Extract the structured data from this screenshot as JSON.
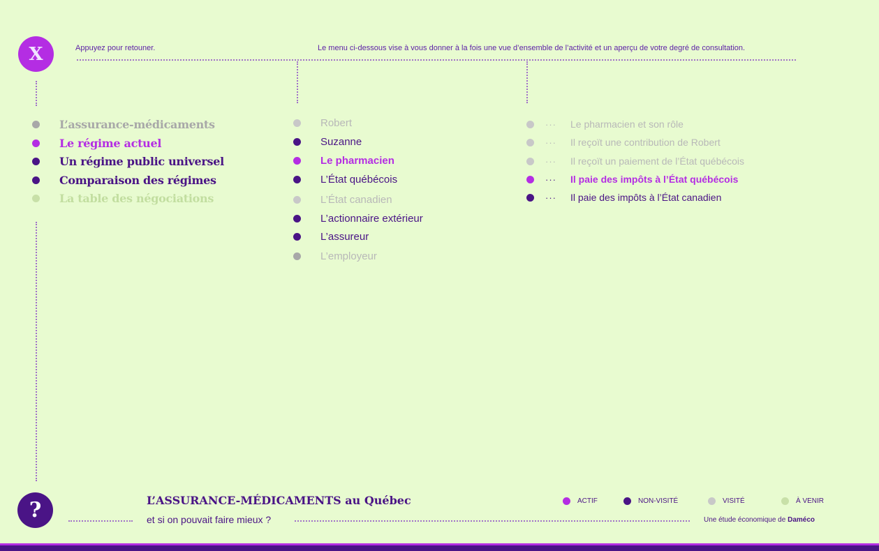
{
  "header": {
    "close_icon": "x-icon",
    "close_glyph": "X",
    "back_text": "Appuyez pour retouner.",
    "description": "Le menu ci-dessous vise à vous donner à la fois une vue d’ensemble de l’activité et un aperçu de votre degré de consultation."
  },
  "column1": [
    {
      "label": "L’assurance-médicaments",
      "state": "gray"
    },
    {
      "label": "Le régime actuel",
      "state": "active"
    },
    {
      "label": "Un régime public universel",
      "state": "unvisited"
    },
    {
      "label": "Comparaison des régimes",
      "state": "unvisited"
    },
    {
      "label": "La table des négociations",
      "state": "upcoming"
    }
  ],
  "column2": [
    {
      "label": "Robert",
      "state": "visited"
    },
    {
      "label": "Suzanne",
      "state": "unvisited"
    },
    {
      "label": "Le pharmacien",
      "state": "active"
    },
    {
      "label": "L’État québécois",
      "state": "unvisited"
    },
    {
      "label": "L’État canadien",
      "state": "visited"
    },
    {
      "label": "L’actionnaire extérieur",
      "state": "unvisited"
    },
    {
      "label": "L’assureur",
      "state": "unvisited"
    },
    {
      "label": "L’employeur",
      "state": "gray"
    }
  ],
  "column3": [
    {
      "lead": "···",
      "label": "Le pharmacien et son rôle",
      "state": "visited"
    },
    {
      "lead": "···",
      "label": "Il reçoït une contribution de Robert",
      "state": "visited"
    },
    {
      "lead": "···",
      "label": "Il reçoït un paiement de l’État québécois",
      "state": "visited"
    },
    {
      "lead": "···",
      "label": "Il paie des impôts à l’État québécois",
      "state": "active"
    },
    {
      "lead": "···",
      "label": "Il paie des impôts à l’État canadien",
      "state": "unvisited"
    }
  ],
  "footer": {
    "help_icon": "question-icon",
    "help_glyph": "?",
    "title": "L’ASSURANCE-MÉDICAMENTS au Québec",
    "subtitle": "et si on pouvait faire mieux ?",
    "credit_prefix": "Une étude économique de ",
    "credit_brand": "Daméco"
  },
  "legend": [
    {
      "label": "ACTIF",
      "state": "active"
    },
    {
      "label": "NON-VISITÉ",
      "state": "unvisited"
    },
    {
      "label": "VISITÉ",
      "state": "visited"
    },
    {
      "label": "À VENIR",
      "state": "upcoming"
    }
  ],
  "colors": {
    "background": "#e8fbd0",
    "active": "#b42de3",
    "unvisited": "#4a1486",
    "visited": "#c8c8c8",
    "upcoming": "#c8e0a8"
  }
}
